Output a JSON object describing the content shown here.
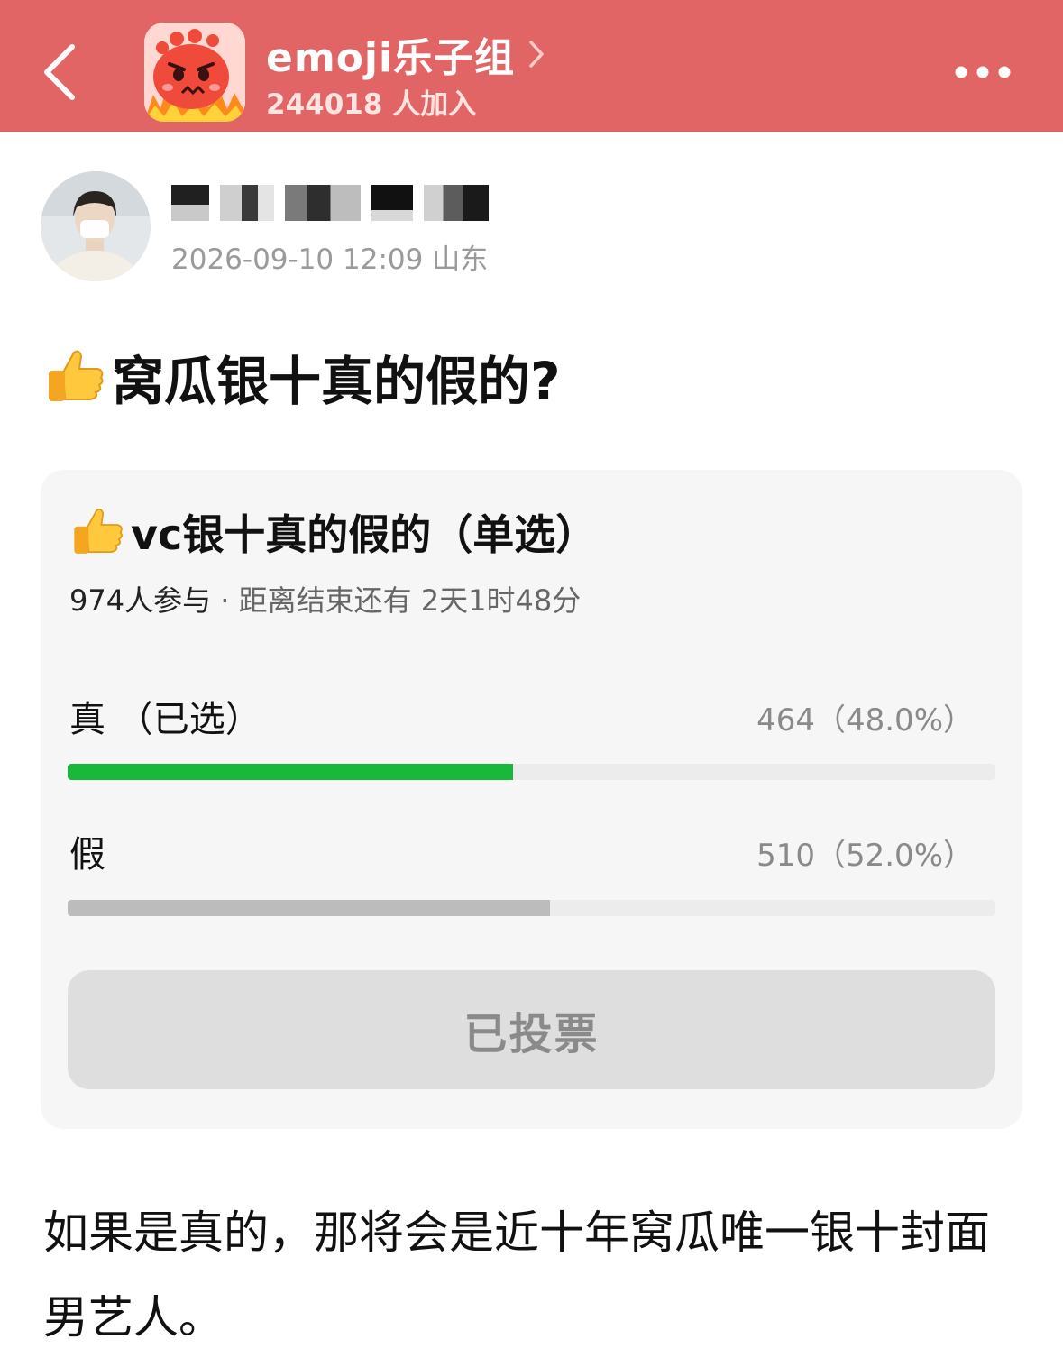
{
  "header": {
    "group_name": "emoji乐子组",
    "members": "244018 人加入",
    "accent_color": "#e26565"
  },
  "author": {
    "meta": "2026-09-10 12:09  山东"
  },
  "post": {
    "title": "窝瓜银十真的假的?",
    "body": "如果是真的，那将会是近十年窝瓜唯一银十封面男艺人。"
  },
  "poll": {
    "title": "vc银十真的假的（单选）",
    "participants": "974人参与",
    "separator": " · ",
    "remaining": "距离结束还有 2天1时48分",
    "options": [
      {
        "label": "真 （已选）",
        "value": "464（48.0%）",
        "fraction": 0.48,
        "color": "#19b83b"
      },
      {
        "label": "假",
        "value": "510（52.0%）",
        "fraction": 0.52,
        "color": "#bcbcbc"
      }
    ],
    "button_label": "已投票"
  },
  "icons": {
    "back": "chevron-left-icon",
    "more": "more-dots-icon",
    "title_emoji": "thumbs-up-icon"
  }
}
